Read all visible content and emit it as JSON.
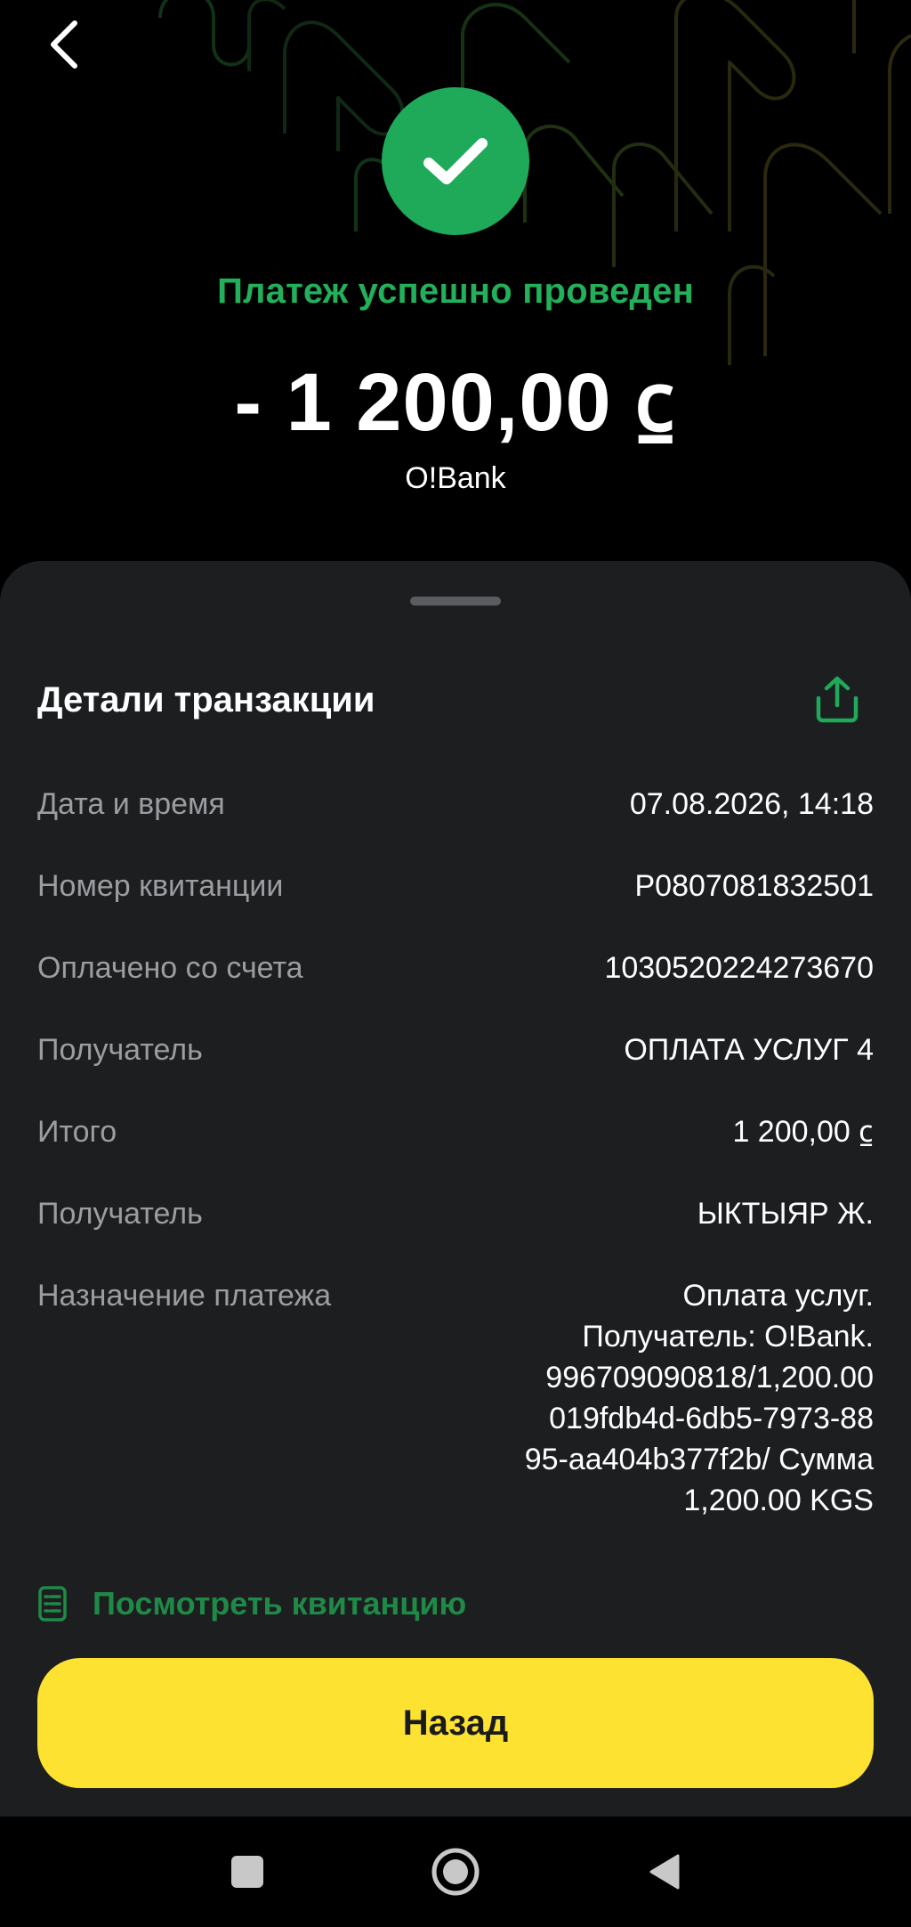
{
  "header": {
    "back_icon": "chevron-left-icon",
    "status_icon": "check-icon",
    "status_title": "Платеж успешно проведен",
    "amount": "- 1 200,00 ⃀",
    "bank": "O!Bank"
  },
  "details": {
    "title": "Детали транзакции",
    "share_icon": "share-icon",
    "rows": [
      {
        "label": "Дата и время",
        "value": "07.08.2026, 14:18"
      },
      {
        "label": "Номер квитанции",
        "value": "P0807081832501"
      },
      {
        "label": "Оплачено со счета",
        "value": "1030520224273670"
      },
      {
        "label": "Получатель",
        "value": "ОПЛАТА УСЛУГ 4"
      },
      {
        "label": "Итого",
        "value": "1 200,00 ⃀"
      },
      {
        "label": "Получатель",
        "value": "ЫКТЫЯР Ж."
      },
      {
        "label": "Назначение платежа",
        "value_lines": [
          "Оплата услуг.",
          "Получатель: O!Bank.",
          "996709090818/1,200.00",
          "019fdb4d-6db5-7973-88",
          "95-aa404b377f2b/ Сумма",
          "1,200.00 KGS"
        ]
      }
    ],
    "receipt_link": "Посмотреть квитанцию",
    "receipt_icon": "receipt-icon"
  },
  "actions": {
    "back_label": "Назад"
  },
  "system_nav": {
    "items": [
      "recents-square-icon",
      "home-circle-icon",
      "back-triangle-icon"
    ]
  },
  "colors": {
    "success_green": "#1faa5a",
    "title_green": "#22b05b",
    "link_green": "#1f8a47",
    "sheet_bg": "#1d1e20",
    "button_yellow": "#fde232",
    "label_gray": "#9c9da1"
  }
}
